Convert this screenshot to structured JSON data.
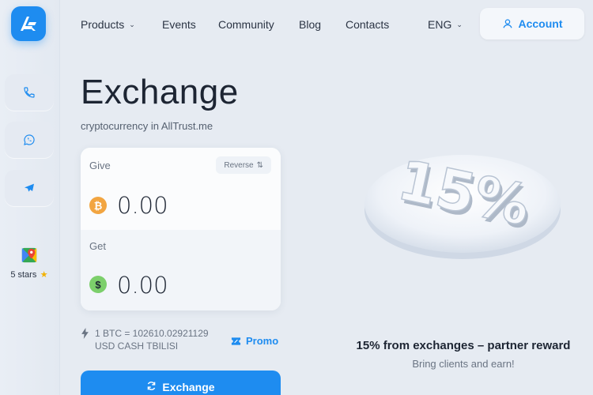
{
  "nav": {
    "products": "Products",
    "events": "Events",
    "community": "Community",
    "blog": "Blog",
    "contacts": "Contacts",
    "language": "ENG",
    "account": "Account"
  },
  "rail": {
    "icons": [
      "phone-icon",
      "whatsapp-icon",
      "telegram-icon"
    ],
    "rating_text": "5 stars"
  },
  "hero": {
    "title": "Exchange",
    "subtitle": "cryptocurrency in AllTrust.me"
  },
  "exchange": {
    "give_label": "Give",
    "reverse_label": "Reverse",
    "give_amount": "0.00",
    "get_label": "Get",
    "get_amount": "0.00",
    "give_currency_icon": "bitcoin-icon",
    "get_currency_icon": "dollar-icon",
    "rate_line1": "1 BTC = 102610.02921129",
    "rate_line2": "USD CASH TBILISI",
    "promo_label": "Promo",
    "button_label": "Exchange"
  },
  "banner": {
    "badge_text": "15%",
    "title": "15% from exchanges – partner reward",
    "subtitle": "Bring clients and earn!"
  },
  "colors": {
    "accent": "#1e8cf0",
    "bitcoin": "#f2a541",
    "dollar": "#7ccf6b",
    "background": "#e6ebf2"
  }
}
